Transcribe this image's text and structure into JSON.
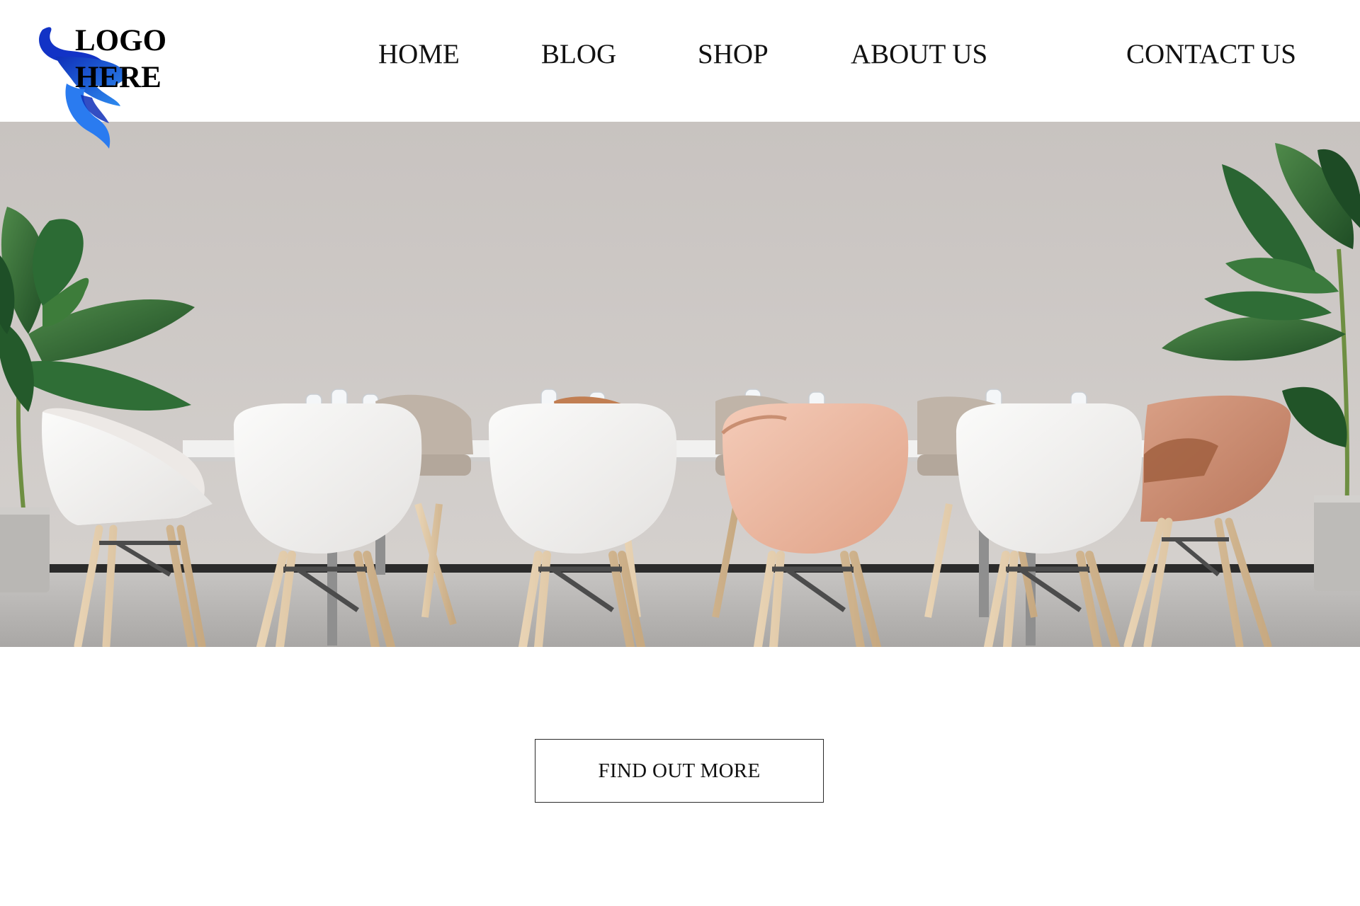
{
  "logo": {
    "line1": "LOGO",
    "line2": "HERE",
    "mark_color": "#1f5fe0",
    "icon": "horned-bull-logo"
  },
  "nav": {
    "items": [
      {
        "label": "HOME"
      },
      {
        "label": "BLOG"
      },
      {
        "label": "SHOP"
      },
      {
        "label": "ABOUT US"
      },
      {
        "label": "CONTACT US"
      }
    ]
  },
  "hero": {
    "scene": "meeting-room-photo"
  },
  "cta": {
    "label": "FIND OUT MORE"
  },
  "colors": {
    "background": "#ffffff",
    "text": "#111111",
    "wall": "#cbc6c3",
    "floor": "#b9b7b5",
    "accent_chair_pink": "#e9b7a2",
    "accent_chair_tan": "#c98f72",
    "logo_blue": "#1f5fe0"
  }
}
